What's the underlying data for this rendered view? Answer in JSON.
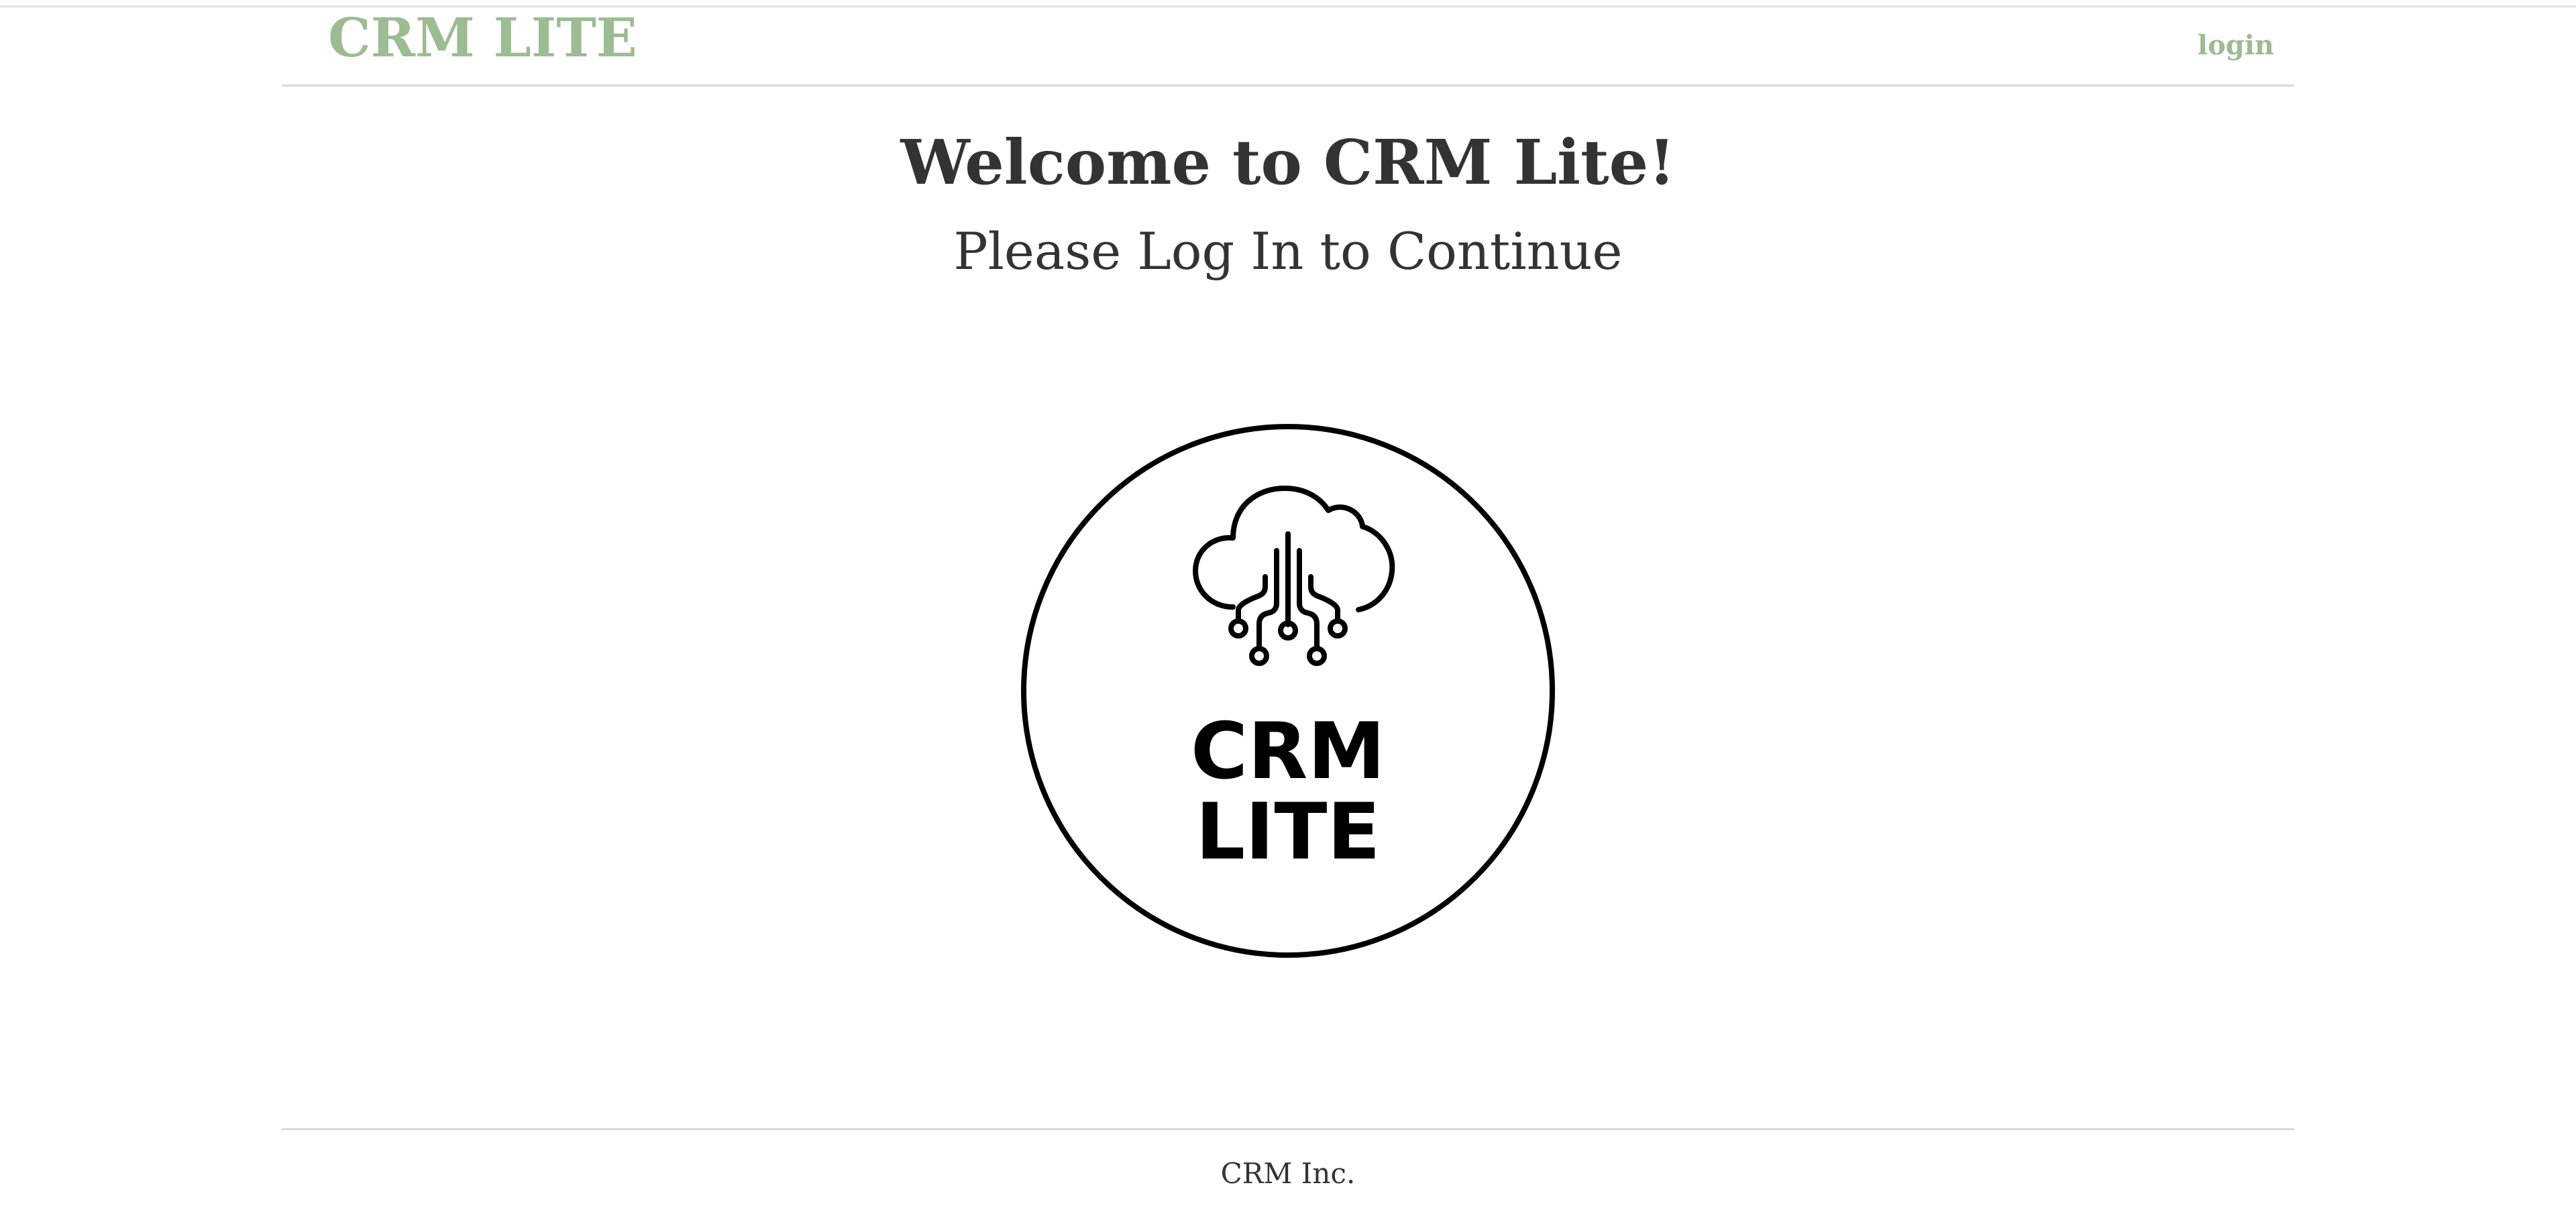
{
  "header": {
    "brand": "CRM LITE",
    "login_label": "login"
  },
  "main": {
    "welcome_heading": "Welcome to CRM Lite!",
    "subtitle": "Please Log In to Continue",
    "logo": {
      "icon": "cloud-circuit-icon",
      "line1": "CRM",
      "line2": "LITE"
    }
  },
  "footer": {
    "text": "CRM Inc."
  },
  "colors": {
    "brand": "#9cbc91",
    "text": "#333333",
    "divider": "#d9d9d9"
  }
}
